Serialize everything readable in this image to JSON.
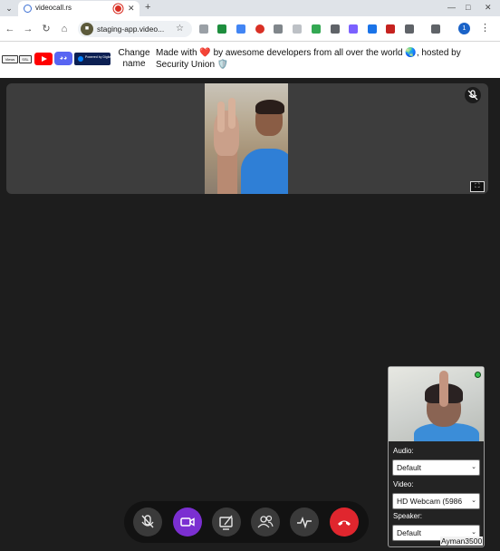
{
  "browser": {
    "tab_title": "videocall.rs",
    "new_tab_symbol": "+",
    "url": "staging-app.video...",
    "tab_menu_symbol": "⌄",
    "close_symbol": "✕",
    "minimize_symbol": "—",
    "maximize_symbol": "□",
    "profile_initial": "1"
  },
  "header": {
    "badge_views": "Views",
    "badge_ssl": "SSL",
    "do_badge_text": "Powered by DigitalOcean",
    "change_name": "Change name",
    "made_with_prefix": "Made with",
    "made_with_middle": "by awesome developers from all over the world",
    "made_with_suffix": "hosted by Security Union",
    "emoji_heart": "❤️",
    "emoji_globe": "🌏",
    "emoji_shield": "🛡️"
  },
  "remote_peer": {
    "muted_icon": "mic-off-icon",
    "expand_icon_symbol": "⛶"
  },
  "self_view": {
    "audio_label": "Audio:",
    "audio_value": "Default",
    "video_label": "Video:",
    "video_value": "HD Webcam (5986",
    "speaker_label": "Speaker:",
    "speaker_value": "Default",
    "user_name": "Ayman3500"
  },
  "controls": {
    "items": [
      "mic-off-icon",
      "video-icon",
      "screen-share-icon",
      "peers-icon",
      "diagnostics-icon",
      "hangup-icon"
    ]
  },
  "colors": {
    "video_active": "#7b2fd1",
    "hangup": "#e0262e",
    "self_status_dot": "#37c24c"
  }
}
